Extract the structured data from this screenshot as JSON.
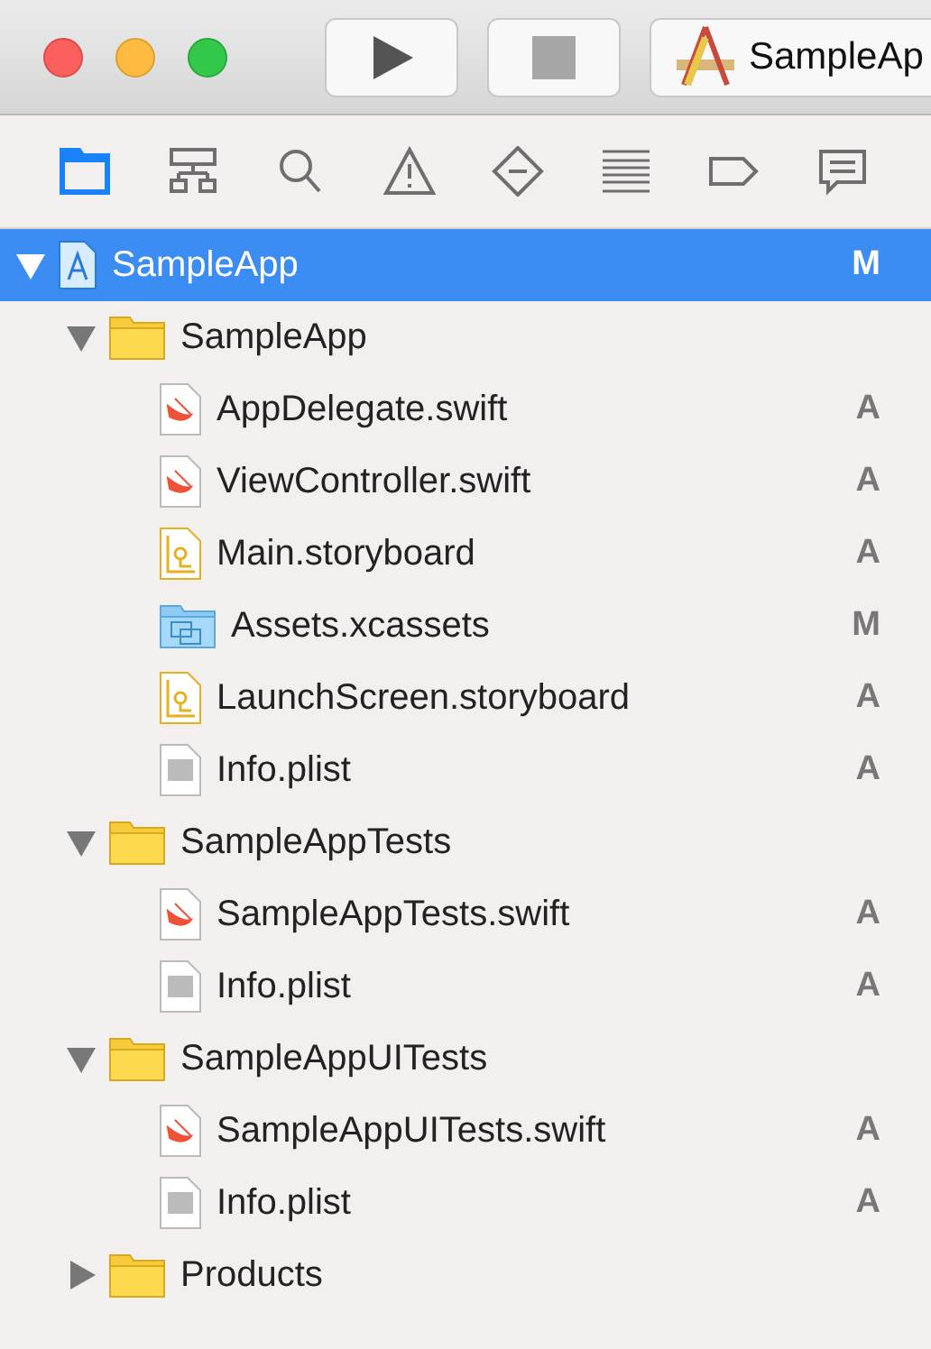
{
  "window": {
    "scheme": "SampleAp"
  },
  "navigator_tabs": [
    {
      "kind": "project",
      "selected": true
    },
    {
      "kind": "symbol",
      "selected": false
    },
    {
      "kind": "find",
      "selected": false
    },
    {
      "kind": "issue",
      "selected": false
    },
    {
      "kind": "test",
      "selected": false
    },
    {
      "kind": "debug",
      "selected": false
    },
    {
      "kind": "breakpoint",
      "selected": false
    },
    {
      "kind": "report",
      "selected": false
    }
  ],
  "tree": [
    {
      "name": "SampleApp",
      "kind": "project",
      "status": "M",
      "expanded": true,
      "selected": true,
      "children": [
        {
          "name": "SampleApp",
          "kind": "folder",
          "expanded": true,
          "selected": false,
          "children": [
            {
              "name": "AppDelegate.swift",
              "kind": "swift",
              "status": "A",
              "selected": false
            },
            {
              "name": "ViewController.swift",
              "kind": "swift",
              "status": "A",
              "selected": false
            },
            {
              "name": "Main.storyboard",
              "kind": "storyboard",
              "status": "A",
              "selected": false
            },
            {
              "name": "Assets.xcassets",
              "kind": "assets",
              "status": "M",
              "selected": false
            },
            {
              "name": "LaunchScreen.storyboard",
              "kind": "storyboard",
              "status": "A",
              "selected": false
            },
            {
              "name": "Info.plist",
              "kind": "plist",
              "status": "A",
              "selected": false
            }
          ]
        },
        {
          "name": "SampleAppTests",
          "kind": "folder",
          "expanded": true,
          "selected": false,
          "children": [
            {
              "name": "SampleAppTests.swift",
              "kind": "swift",
              "status": "A",
              "selected": false
            },
            {
              "name": "Info.plist",
              "kind": "plist",
              "status": "A",
              "selected": false
            }
          ]
        },
        {
          "name": "SampleAppUITests",
          "kind": "folder",
          "expanded": true,
          "selected": false,
          "children": [
            {
              "name": "SampleAppUITests.swift",
              "kind": "swift",
              "status": "A",
              "selected": false
            },
            {
              "name": "Info.plist",
              "kind": "plist",
              "status": "A",
              "selected": false
            }
          ]
        },
        {
          "name": "Products",
          "kind": "folder",
          "expanded": false,
          "selected": false
        }
      ]
    }
  ]
}
